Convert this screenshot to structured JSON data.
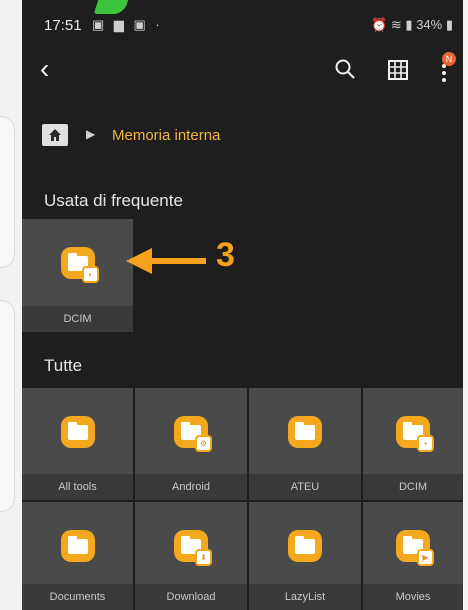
{
  "status_bar": {
    "time": "17:51",
    "right": "34%"
  },
  "breadcrumb": {
    "location": "Memoria interna"
  },
  "sections": {
    "frequent": "Usata di frequente",
    "all": "Tutte"
  },
  "frequent_folders": [
    {
      "label": "DCIM",
      "icon": "image-overlay"
    }
  ],
  "all_folders": [
    {
      "label": "All tools",
      "icon": "none"
    },
    {
      "label": "Android",
      "icon": "gear-overlay"
    },
    {
      "label": "ATEU",
      "icon": "none"
    },
    {
      "label": "DCIM",
      "icon": "image-overlay"
    },
    {
      "label": "Documents",
      "icon": "none"
    },
    {
      "label": "Download",
      "icon": "download-overlay"
    },
    {
      "label": "LazyList",
      "icon": "none"
    },
    {
      "label": "Movies",
      "icon": "play-overlay"
    }
  ],
  "annotation": {
    "number": "3",
    "color": "#f6a11c"
  },
  "notification_badge": "N",
  "colors": {
    "background": "#1e1e1e",
    "tile": "#4a4a4a",
    "folder": "#f3a81d",
    "accent": "#f1b440"
  }
}
